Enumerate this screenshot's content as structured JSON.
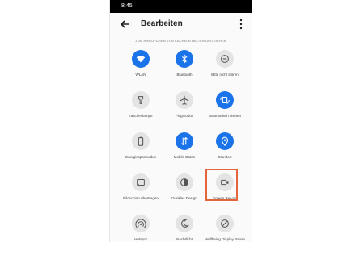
{
  "status_bar": {
    "time": "8:45"
  },
  "app_bar": {
    "title": "Bearbeiten"
  },
  "hint_text": "ZUM HINZUFÜGEN VON KACHELN HALTEN UND ZIEHEN",
  "tiles": [
    {
      "label": "WLAN",
      "icon": "wifi-icon",
      "active": true
    },
    {
      "label": "Bluetooth",
      "icon": "bluetooth-icon",
      "active": true
    },
    {
      "label": "Bitte nicht stören",
      "icon": "do-not-disturb-icon",
      "active": false
    },
    {
      "label": "Taschenlampe",
      "icon": "flashlight-icon",
      "active": false
    },
    {
      "label": "Flugmodus",
      "icon": "airplane-icon",
      "active": false
    },
    {
      "label": "Automatisch drehen",
      "icon": "auto-rotate-icon",
      "active": true
    },
    {
      "label": "Energiesparmodus",
      "icon": "battery-saver-icon",
      "active": false
    },
    {
      "label": "Mobile Daten",
      "icon": "mobile-data-icon",
      "active": true
    },
    {
      "label": "Standort",
      "icon": "location-icon",
      "active": true
    },
    {
      "label": "Bildschirm übertragen",
      "icon": "cast-icon",
      "active": false
    },
    {
      "label": "Dunkles Design",
      "icon": "dark-theme-icon",
      "active": false
    },
    {
      "label": "Screen Record",
      "icon": "screen-record-icon",
      "active": false
    },
    {
      "label": "Hotspot",
      "icon": "hotspot-icon",
      "active": false
    },
    {
      "label": "Nachtlicht",
      "icon": "night-light-icon",
      "active": false
    },
    {
      "label": "Wellbeing Display Pause",
      "icon": "display-pause-icon",
      "active": false
    }
  ],
  "highlighted_tile": "Screen Record",
  "colors": {
    "accent": "#1a73e8",
    "highlight": "#e4643c",
    "inactive": "#e4e4e4"
  }
}
